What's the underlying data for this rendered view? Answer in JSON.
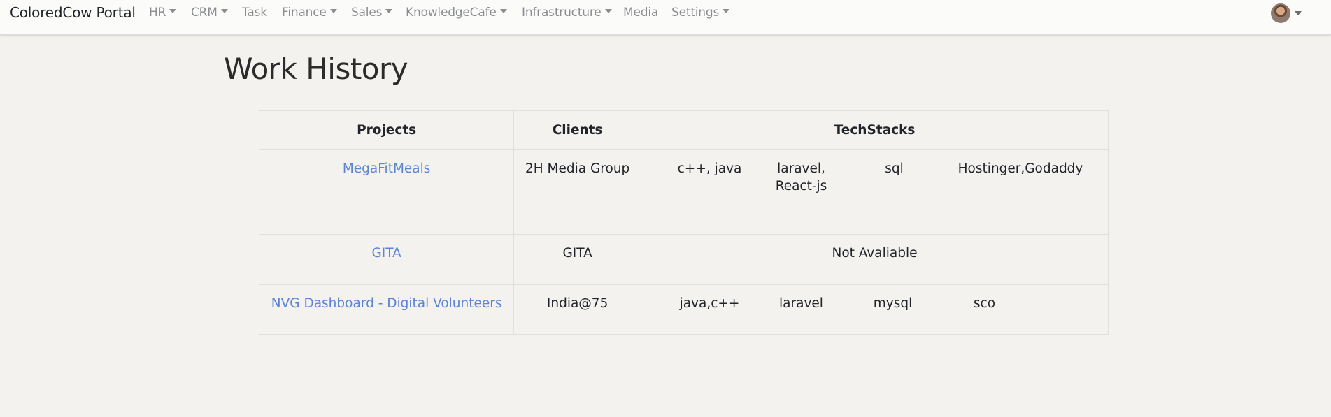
{
  "navbar": {
    "brand": "ColoredCow Portal",
    "items": [
      {
        "label": "HR",
        "dropdown": true
      },
      {
        "label": "CRM",
        "dropdown": true
      },
      {
        "label": "Task",
        "dropdown": false
      },
      {
        "label": "Finance",
        "dropdown": true
      },
      {
        "label": "Sales",
        "dropdown": true
      },
      {
        "label": "KnowledgeCafe",
        "dropdown": true
      },
      {
        "label": "Infrastructure",
        "dropdown": true
      },
      {
        "label": "Media",
        "dropdown": false
      },
      {
        "label": "Settings",
        "dropdown": true
      }
    ],
    "user_icon": "avatar"
  },
  "page": {
    "title": "Work History"
  },
  "table": {
    "headers": [
      "Projects",
      "Clients",
      "TechStacks"
    ],
    "rows": [
      {
        "project": "MegaFitMeals",
        "client": "2H Media Group",
        "stacks": [
          "c++, java",
          "laravel, React-js",
          "sql",
          "Hostinger,Godaddy"
        ]
      },
      {
        "project": "GITA",
        "client": "GITA",
        "stacks": [],
        "empty_text": "Not Avaliable"
      },
      {
        "project": "NVG Dashboard - Digital Volunteers",
        "client": "India@75",
        "stacks": [
          "java,c++",
          "laravel",
          "mysql",
          "sco"
        ]
      }
    ]
  },
  "colors": {
    "link": "#5d84d4",
    "background": "#f3f2ee",
    "navbar": "#fbfbfa"
  }
}
